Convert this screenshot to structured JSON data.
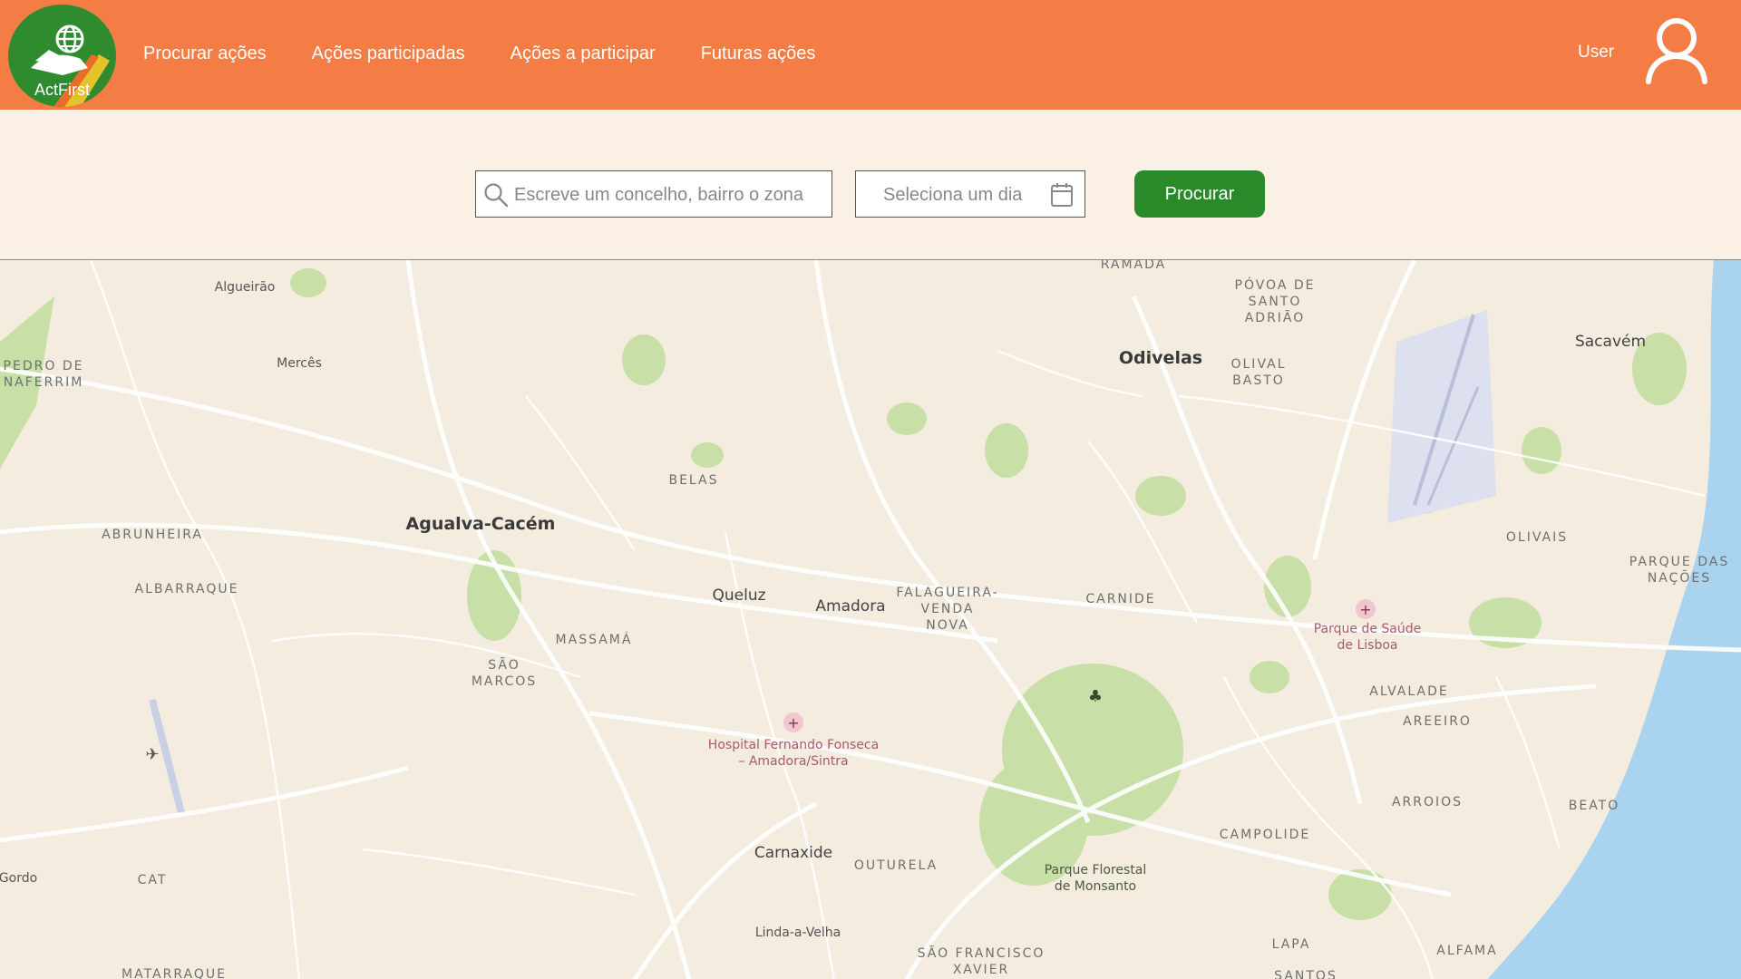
{
  "app": {
    "logo_text": "ActFirst",
    "colors": {
      "header": "#f47c45",
      "background": "#fbf0e4",
      "accent": "#2a8a2a",
      "water": "#a9d3ee",
      "park": "#c8dfa7"
    }
  },
  "nav": {
    "items": [
      {
        "label": "Procurar ações"
      },
      {
        "label": "Ações participadas"
      },
      {
        "label": "Ações a participar"
      },
      {
        "label": "Futuras ações"
      }
    ]
  },
  "user": {
    "label": "User",
    "icon": "user-icon"
  },
  "search": {
    "location_placeholder": "Escreve um concelho, bairro o zona",
    "location_value": "",
    "date_placeholder": "Seleciona um dia",
    "date_value": "",
    "button_label": "Procurar",
    "search_icon": "search-icon",
    "calendar_icon": "calendar-icon"
  },
  "map": {
    "places": [
      {
        "name": "Algueirão",
        "kind": "small"
      },
      {
        "name": "Mercês",
        "kind": "small"
      },
      {
        "name": "PEDRO DE\nNAFERRIM",
        "kind": "district"
      },
      {
        "name": "ABRUNHEIRA",
        "kind": "district"
      },
      {
        "name": "ALBARRAQUE",
        "kind": "district"
      },
      {
        "name": "Agualva-Cacém",
        "kind": "major"
      },
      {
        "name": "BELAS",
        "kind": "district"
      },
      {
        "name": "Queluz",
        "kind": "city"
      },
      {
        "name": "Amadora",
        "kind": "city"
      },
      {
        "name": "FALAGUEIRA-\nVENDA\nNOVA",
        "kind": "district"
      },
      {
        "name": "MASSAMÁ",
        "kind": "district"
      },
      {
        "name": "SÃO\nMARCOS",
        "kind": "district"
      },
      {
        "name": "Hospital Fernando Fonseca\n– Amadora/Sintra",
        "kind": "poi"
      },
      {
        "name": "Carnaxide",
        "kind": "city"
      },
      {
        "name": "OUTURELA",
        "kind": "district"
      },
      {
        "name": "Linda-a-Velha",
        "kind": "small"
      },
      {
        "name": "SÃO FRANCISCO\nXAVIER",
        "kind": "district"
      },
      {
        "name": "Parque Florestal\nde Monsanto",
        "kind": "park"
      },
      {
        "name": "CAT",
        "kind": "district"
      },
      {
        "name": "Gordo",
        "kind": "small"
      },
      {
        "name": "MATARRAQUE",
        "kind": "district"
      },
      {
        "name": "RAMADA",
        "kind": "district"
      },
      {
        "name": "PÓVOA DE\nSANTO\nADRIÃO",
        "kind": "district"
      },
      {
        "name": "Odivelas",
        "kind": "major"
      },
      {
        "name": "OLIVAL\nBASTO",
        "kind": "district"
      },
      {
        "name": "Sacavém",
        "kind": "city"
      },
      {
        "name": "CARNIDE",
        "kind": "district"
      },
      {
        "name": "Parque de Saúde\nde Lisboa",
        "kind": "poi"
      },
      {
        "name": "OLIVAIS",
        "kind": "district"
      },
      {
        "name": "PARQUE DAS\nNAÇÕES",
        "kind": "district"
      },
      {
        "name": "ALVALADE",
        "kind": "district"
      },
      {
        "name": "AREEIRO",
        "kind": "district"
      },
      {
        "name": "ARROIOS",
        "kind": "district"
      },
      {
        "name": "BEATO",
        "kind": "district"
      },
      {
        "name": "CAMPOLIDE",
        "kind": "district"
      },
      {
        "name": "LAPA",
        "kind": "district"
      },
      {
        "name": "ALFAMA",
        "kind": "district"
      },
      {
        "name": "SANTOS",
        "kind": "district"
      }
    ]
  }
}
